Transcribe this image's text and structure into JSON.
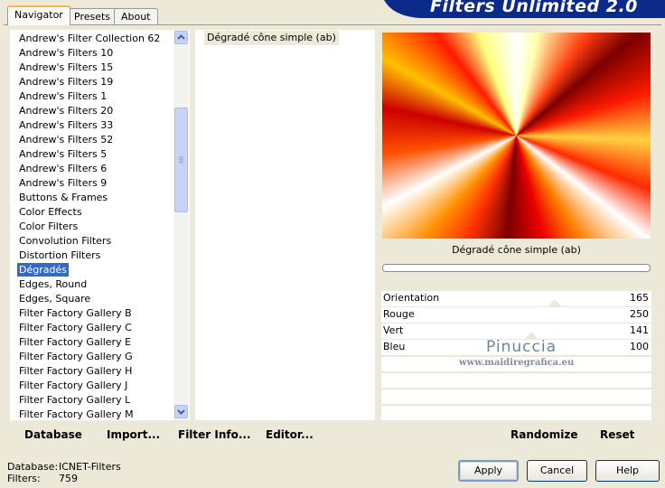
{
  "tabs": [
    {
      "label": "Navigator",
      "active": true
    },
    {
      "label": "Presets",
      "active": false
    },
    {
      "label": "About",
      "active": false
    }
  ],
  "banner": {
    "title": "Filters Unlimited 2.0",
    "color": "#0b2a8a"
  },
  "filter_list": {
    "items": [
      "Andrew's Filter Collection 62",
      "Andrew's Filters 10",
      "Andrew's Filters 15",
      "Andrew's Filters 19",
      "Andrew's Filters 1",
      "Andrew's Filters 20",
      "Andrew's Filters 33",
      "Andrew's Filters 52",
      "Andrew's Filters 5",
      "Andrew's Filters 6",
      "Andrew's Filters 9",
      "Buttons & Frames",
      "Color Effects",
      "Color Filters",
      "Convolution Filters",
      "Distortion Filters",
      "Dégradés",
      "Edges, Round",
      "Edges, Square",
      "Filter Factory Gallery B",
      "Filter Factory Gallery C",
      "Filter Factory Gallery E",
      "Filter Factory Gallery G",
      "Filter Factory Gallery H",
      "Filter Factory Gallery J",
      "Filter Factory Gallery L",
      "Filter Factory Gallery M"
    ],
    "selected": "Dégradés",
    "selection_color": "#316ac5"
  },
  "effect_list": {
    "items": [
      "Dégradé cône simple (ab)"
    ],
    "selected": "Dégradé cône simple (ab)"
  },
  "preview": {
    "title": "Dégradé cône simple (ab)"
  },
  "params": [
    {
      "label": "Orientation",
      "value": "165"
    },
    {
      "label": "Rouge",
      "value": "250"
    },
    {
      "label": "Vert",
      "value": "141"
    },
    {
      "label": "Bleu",
      "value": "100"
    }
  ],
  "watermark": {
    "name": "Pinuccia",
    "url": "www.maidiregrafica.eu"
  },
  "toolbar": {
    "database": "Database",
    "import": "Import...",
    "filter_info": "Filter Info...",
    "editor": "Editor...",
    "randomize": "Randomize",
    "reset": "Reset"
  },
  "status": {
    "database_label": "Database:",
    "database_value": "ICNET-Filters",
    "filters_label": "Filters:",
    "filters_value": "759"
  },
  "buttons": {
    "apply": "Apply",
    "cancel": "Cancel",
    "help": "Help"
  }
}
